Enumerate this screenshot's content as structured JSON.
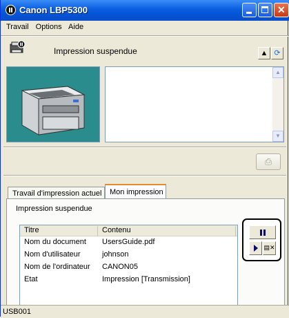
{
  "window": {
    "title": "Canon LBP5300"
  },
  "menu": [
    "Travail",
    "Options",
    "Aide"
  ],
  "header": {
    "status": "Impression suspendue"
  },
  "tabs": [
    "Travail d'impression actuel",
    "Mon impression"
  ],
  "panel": {
    "status": "Impression suspendue",
    "table": {
      "columns": [
        "Titre",
        "Contenu"
      ],
      "rows": [
        [
          "Nom du document",
          "UsersGuide.pdf"
        ],
        [
          "Nom d'utilisateur",
          "johnson"
        ],
        [
          "Nom de l'ordinateur",
          "CANON05"
        ],
        [
          "Etat",
          "Impression [Transmission]"
        ]
      ]
    }
  },
  "statusbar": {
    "port": "USB001"
  },
  "icons": {
    "app": "pause-icon",
    "printer": "printer-icon",
    "properties": "printer-properties-icon",
    "refresh": "refresh-icon",
    "print": "print-icon",
    "pause": "pause-icon",
    "resume": "play-icon",
    "cancel": "cancel-job-icon"
  },
  "colors": {
    "title_bar": "#0a5ee0",
    "image_background": "#2a8c8c",
    "active_tab": "#e68b2c",
    "control_icons": "#0b0b6b"
  }
}
